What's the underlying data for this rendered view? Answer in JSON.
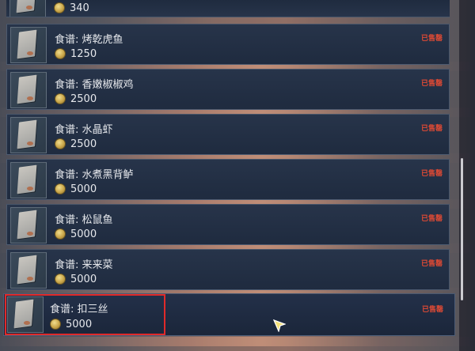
{
  "currency_icon": "gold-coin-icon",
  "status_color": "#e04a34",
  "highlight_color": "#e02a2a",
  "partial_item": {
    "amount": "340"
  },
  "items": [
    {
      "title": "食谱: 烤乾虎鱼",
      "amount": "1250",
      "status": "已售罄"
    },
    {
      "title": "食谱: 香嫩椒椒鸡",
      "amount": "2500",
      "status": "已售罄"
    },
    {
      "title": "食谱: 水晶虾",
      "amount": "2500",
      "status": "已售罄"
    },
    {
      "title": "食谱: 水煮黑背鲈",
      "amount": "5000",
      "status": "已售罄"
    },
    {
      "title": "食谱: 松鼠鱼",
      "amount": "5000",
      "status": "已售罄"
    },
    {
      "title": "食谱: 来来菜",
      "amount": "5000",
      "status": "已售罄"
    },
    {
      "title": "食谱: 扣三丝",
      "amount": "5000",
      "status": "已售罄"
    }
  ]
}
